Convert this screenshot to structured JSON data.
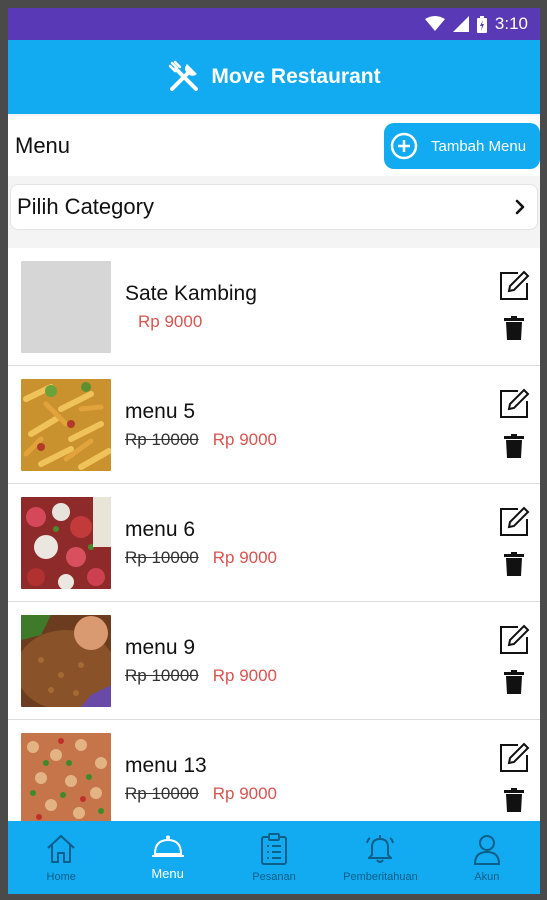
{
  "status": {
    "time": "3:10"
  },
  "appbar": {
    "title": "Move Restaurant"
  },
  "header": {
    "title": "Menu",
    "add_button": "Tambah Menu"
  },
  "category": {
    "label": "Pilih Category"
  },
  "items": [
    {
      "name": "Sate Kambing",
      "old_price": "",
      "price": "Rp 9000",
      "image": "placeholder"
    },
    {
      "name": "menu 5",
      "old_price": "Rp 10000",
      "price": "Rp 9000",
      "image": "pasta"
    },
    {
      "name": "menu 6",
      "old_price": "Rp 10000",
      "price": "Rp 9000",
      "image": "salad"
    },
    {
      "name": "menu 9",
      "old_price": "Rp 10000",
      "price": "Rp 9000",
      "image": "rice"
    },
    {
      "name": "menu 13",
      "old_price": "Rp 10000",
      "price": "Rp 9000",
      "image": "beans"
    }
  ],
  "nav": [
    {
      "label": "Home",
      "icon": "home-icon"
    },
    {
      "label": "Menu",
      "icon": "cloche-icon"
    },
    {
      "label": "Pesanan",
      "icon": "clipboard-icon"
    },
    {
      "label": "Pemberitahuan",
      "icon": "bell-icon"
    },
    {
      "label": "Akun",
      "icon": "user-icon"
    }
  ],
  "colors": {
    "primary": "#12aaf0",
    "statusbar": "#5a39b7",
    "price": "#d9534f"
  }
}
